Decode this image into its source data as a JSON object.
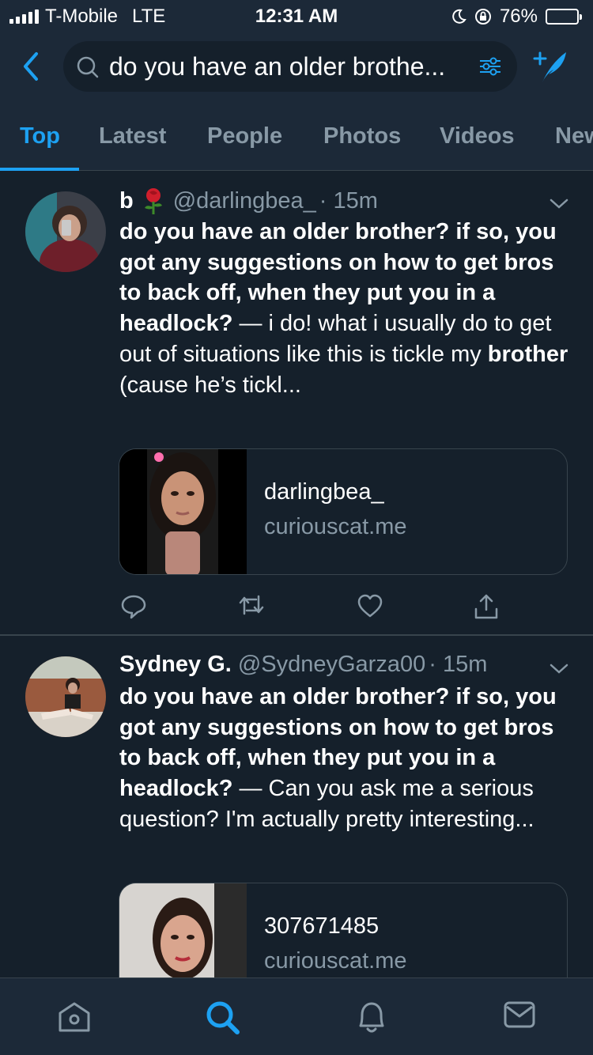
{
  "status_bar": {
    "carrier": "T-Mobile",
    "network": "LTE",
    "time": "12:31 AM",
    "battery": "76%",
    "battery_level": 0.76
  },
  "search": {
    "query": "do you have an older brothe..."
  },
  "tabs": [
    {
      "label": "Top",
      "active": true
    },
    {
      "label": "Latest",
      "active": false
    },
    {
      "label": "People",
      "active": false
    },
    {
      "label": "Photos",
      "active": false
    },
    {
      "label": "Videos",
      "active": false
    },
    {
      "label": "News",
      "active": false
    }
  ],
  "tweets": [
    {
      "name": "b",
      "name_emoji": "rose",
      "handle": "@darlingbea_",
      "time": "· 15m",
      "body_bold": "do you have an older brother? if so, you got any suggestions on how to get bros to back off, when they put you in a headlock?",
      "body_plain": " — i do! what i usually do to get out of situations like this is tickle my ",
      "body_bold2": "brother",
      "body_plain2": " (cause he’s tickl...",
      "card_title": "darlingbea_",
      "card_domain": "curiouscat.me"
    },
    {
      "name": "Sydney G.",
      "handle": "@SydneyGarza00",
      "time": "· 15m",
      "body_bold": "do you have an older brother? if so, you got any suggestions on how to get bros to back off, when they put you in a headlock?",
      "body_plain": " — Can you ask me a serious question? I'm actually pretty interesting...",
      "card_title": "307671485",
      "card_domain": "curiouscat.me"
    }
  ],
  "colors": {
    "background": "#15202b",
    "header": "#1c2938",
    "accent": "#1da1f2",
    "muted": "#8899a6",
    "border": "#38444d"
  },
  "icons": [
    "back-icon",
    "search-icon",
    "filter-icon",
    "compose-icon",
    "chevron-down-icon",
    "reply-icon",
    "retweet-icon",
    "like-icon",
    "share-icon",
    "home-icon",
    "search-nav-icon",
    "notifications-icon",
    "messages-icon"
  ]
}
